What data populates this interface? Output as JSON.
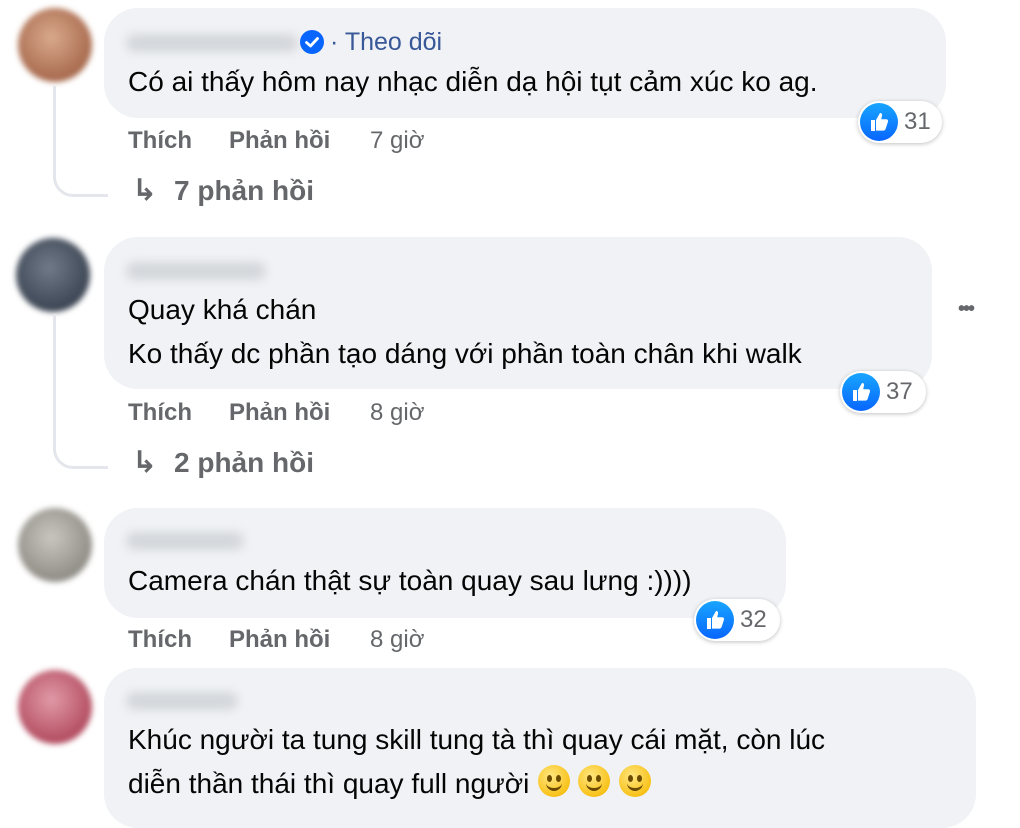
{
  "comments": [
    {
      "follow_label": "· Theo dõi",
      "text_lines": [
        "Có ai thấy hôm nay nhạc diễn dạ hội tụt cảm xúc ko ag."
      ],
      "like_label": "Thích",
      "reply_label": "Phản hồi",
      "time": "7 giờ",
      "reaction_count": "31",
      "replies_label": "7 phản hồi",
      "verified": true
    },
    {
      "text_lines": [
        "Quay khá chán",
        "Ko thấy dc phần tạo dáng với phần toàn chân khi walk"
      ],
      "like_label": "Thích",
      "reply_label": "Phản hồi",
      "time": "8 giờ",
      "reaction_count": "37",
      "replies_label": "2 phản hồi",
      "more_icon": "more-horizontal-icon"
    },
    {
      "text_lines": [
        "Camera chán thật sự toàn quay sau lưng :))))"
      ],
      "like_label": "Thích",
      "reply_label": "Phản hồi",
      "time": "8 giờ",
      "reaction_count": "32"
    },
    {
      "text_lines": [
        "Khúc người ta tung skill tung tà thì quay cái mặt, còn lúc",
        "diễn thần thái thì quay full người"
      ],
      "emoji_count": 3
    }
  ],
  "icons": {
    "reply_arrow": "↳",
    "more": "•••"
  },
  "colors": {
    "bubble": "#f0f2f5",
    "link_blue": "#385898",
    "like_blue": "#0866ff",
    "muted": "#65676b"
  }
}
